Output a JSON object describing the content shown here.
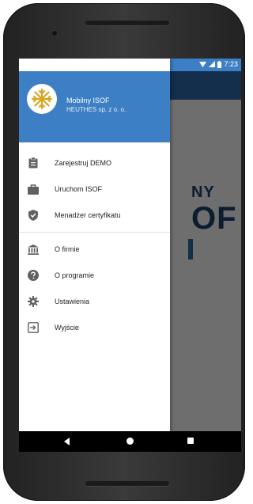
{
  "status_bar": {
    "time": "7:23"
  },
  "background_screen": {
    "line1": "NY",
    "line2": "OF"
  },
  "drawer": {
    "header": {
      "app_name": "Mobilny ISOF",
      "company": "HEUTHES sp. z o. o."
    },
    "items": [
      {
        "label": "Zarejestruj DEMO",
        "icon": "clipboard-icon"
      },
      {
        "label": "Uruchom ISOF",
        "icon": "briefcase-icon"
      },
      {
        "label": "Menadżer certyfikatu",
        "icon": "shield-check-icon"
      },
      {
        "label": "O firmie",
        "icon": "bank-icon"
      },
      {
        "label": "O programie",
        "icon": "help-circle-icon"
      },
      {
        "label": "Ustawienia",
        "icon": "gear-icon"
      },
      {
        "label": "Wyjście",
        "icon": "exit-icon"
      }
    ]
  },
  "colors": {
    "header_blue": "#3d7fc4",
    "appbar_blue": "#2b68a8",
    "icon_gray": "#616161"
  }
}
